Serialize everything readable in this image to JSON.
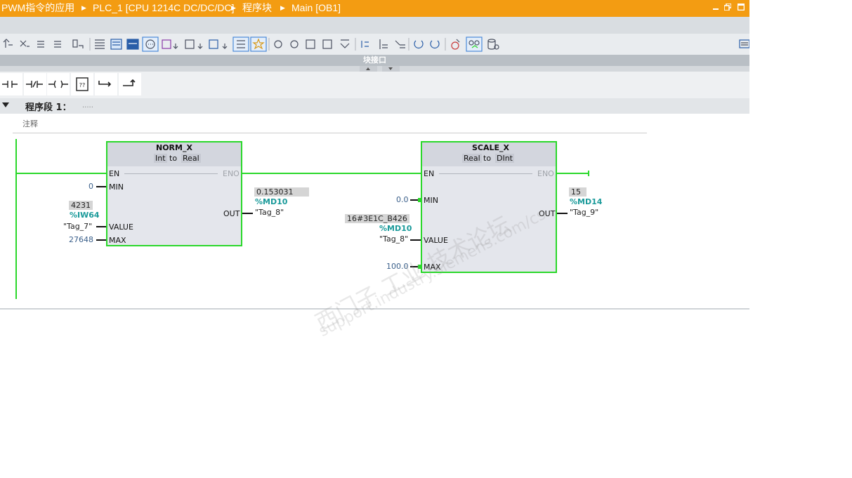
{
  "titlebar": {
    "crumbs": [
      "PWM指令的应用",
      "PLC_1 [CPU 1214C DC/DC/DC]",
      "程序块",
      "Main [OB1]"
    ]
  },
  "panel": {
    "block_interface": "块接口"
  },
  "network": {
    "title": "程序段 1：",
    "dots": ".....",
    "comment": "注释"
  },
  "norm_x": {
    "name": "NORM_X",
    "type_from": "Int",
    "to": "to",
    "type_to": "Real",
    "en": "EN",
    "eno": "ENO",
    "min": "MIN",
    "value": "VALUE",
    "max": "MAX",
    "out": "OUT",
    "min_val": "0",
    "value_monitor": "4231",
    "value_addr": "%IW64",
    "value_tag": "\"Tag_7\"",
    "max_val": "27648",
    "out_monitor": "0.153031",
    "out_addr": "%MD10",
    "out_tag": "\"Tag_8\""
  },
  "scale_x": {
    "name": "SCALE_X",
    "type_from": "Real",
    "to": "to",
    "type_to": "DInt",
    "en": "EN",
    "eno": "ENO",
    "min": "MIN",
    "value": "VALUE",
    "max": "MAX",
    "out": "OUT",
    "min_val": "0.0",
    "value_monitor": "16#3E1C_B426",
    "value_addr": "%MD10",
    "value_tag": "\"Tag_8\"",
    "max_val": "100.0",
    "out_monitor": "15",
    "out_addr": "%MD14",
    "out_tag": "\"Tag_9\""
  },
  "watermark": {
    "cn": "西门子 工业 技术论坛",
    "url": "support.industry.siemens.com/cs"
  },
  "colors": {
    "titlebar": "#f39c12",
    "box_border": "#2ad82a",
    "power_flow": "#2ad82a",
    "address": "#1a9a9a"
  }
}
